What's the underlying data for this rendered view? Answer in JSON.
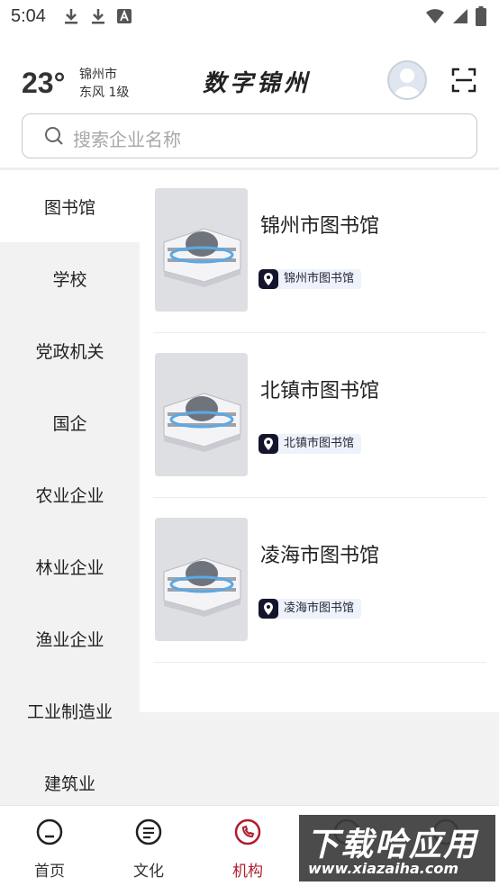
{
  "status_bar": {
    "time": "5:04",
    "left_icons": [
      "download-icon",
      "download-icon",
      "font-a-icon"
    ],
    "right_icons": [
      "wifi-icon",
      "signal-icon",
      "battery-icon"
    ]
  },
  "header": {
    "temperature": "23°",
    "city": "锦州市",
    "wind": "东风 1级",
    "title": "数字锦州"
  },
  "search": {
    "placeholder": "搜索企业名称"
  },
  "sidebar": {
    "items": [
      {
        "label": "图书馆",
        "active": true
      },
      {
        "label": "学校"
      },
      {
        "label": "党政机关"
      },
      {
        "label": "国企"
      },
      {
        "label": "农业企业"
      },
      {
        "label": "林业企业"
      },
      {
        "label": "渔业企业"
      },
      {
        "label": "工业制造业"
      },
      {
        "label": "建筑业"
      }
    ]
  },
  "list": {
    "items": [
      {
        "title": "锦州市图书馆",
        "tag": "锦州市图书馆"
      },
      {
        "title": "北镇市图书馆",
        "tag": "北镇市图书馆"
      },
      {
        "title": "凌海市图书馆",
        "tag": "凌海市图书馆"
      }
    ]
  },
  "bottom_nav": {
    "items": [
      {
        "label": "首页",
        "icon": "home-icon"
      },
      {
        "label": "文化",
        "icon": "culture-icon"
      },
      {
        "label": "机构",
        "icon": "institution-icon",
        "active": true
      },
      {
        "label": "",
        "icon": "nav-item-4-icon"
      },
      {
        "label": "",
        "icon": "nav-item-5-icon"
      }
    ]
  },
  "watermark": {
    "main": "下载哈应用",
    "sub": "www.xiazaiha.com"
  },
  "colors": {
    "accent": "#b01e2e",
    "sidebar_bg": "#f2f2f2",
    "tag_bg": "#eef2fb"
  }
}
